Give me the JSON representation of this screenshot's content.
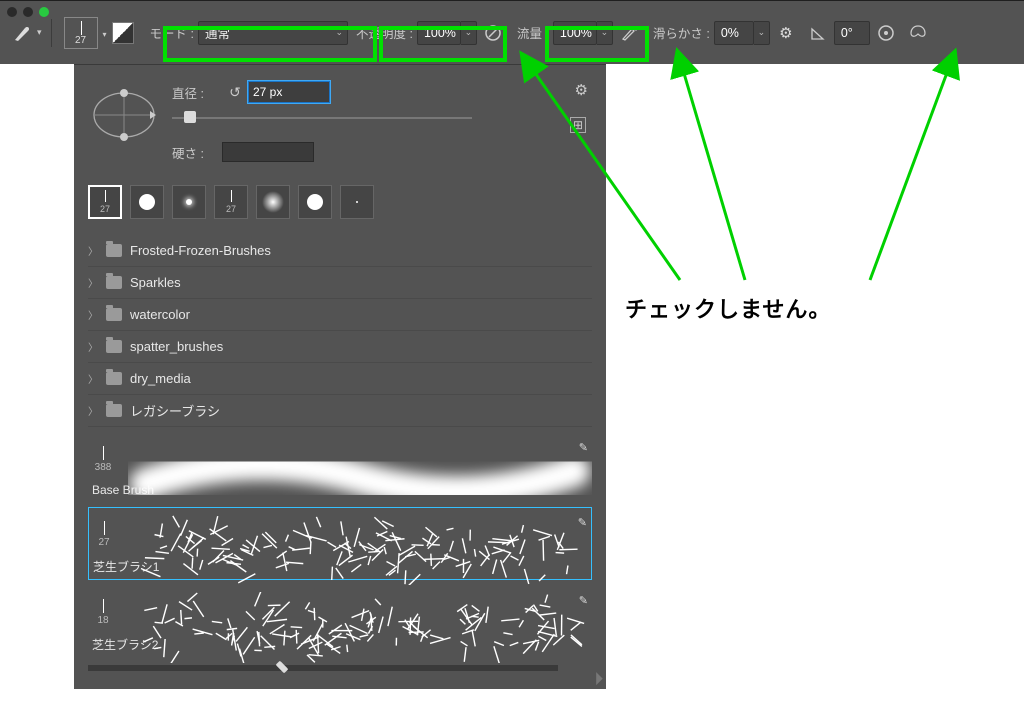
{
  "traffic": {
    "present": true
  },
  "toolbar": {
    "brush_size_display": "27",
    "mode_label": "モード :",
    "mode_value": "通常",
    "opacity_label": "不透明度 :",
    "opacity_value": "100%",
    "flow_label": "流量 :",
    "flow_value": "100%",
    "smooth_label": "滑らかさ :",
    "smooth_value": "0%",
    "angle_value": "0°"
  },
  "panel": {
    "diameter_label": "直径 :",
    "diameter_value": "27 px",
    "hardness_label": "硬さ :",
    "tips": [
      {
        "size": "27",
        "type": "hard-line",
        "selected": true
      },
      {
        "size": "",
        "type": "hard-round"
      },
      {
        "size": "",
        "type": "soft-small"
      },
      {
        "size": "27",
        "type": "hard-line-2"
      },
      {
        "size": "",
        "type": "soft-big"
      },
      {
        "size": "",
        "type": "hard-round-2"
      },
      {
        "size": "",
        "type": "dot"
      }
    ],
    "folders": [
      "Frosted-Frozen-Brushes",
      "Sparkles",
      "watercolor",
      "spatter_brushes",
      "dry_media",
      "レガシーブラシ"
    ],
    "brushes": [
      {
        "size": "388",
        "name": "Base Brush",
        "style": "soft-wave",
        "selected": false
      },
      {
        "size": "27",
        "name": "芝生ブラシ1",
        "style": "grass",
        "selected": true
      },
      {
        "size": "18",
        "name": "芝生ブラシ2",
        "style": "grass",
        "selected": false
      }
    ]
  },
  "annotation": "チェックしません。"
}
